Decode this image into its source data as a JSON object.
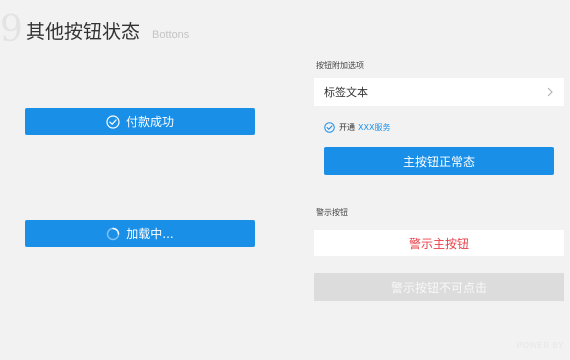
{
  "header": {
    "number": "9",
    "title": "其他按钮状态",
    "subtitle": "Bottons"
  },
  "left": {
    "paid_button": {
      "label": "付款成功",
      "icon": "check-circle-icon"
    },
    "loading_button": {
      "label": "加载中...",
      "icon": "spinner-icon"
    }
  },
  "right": {
    "addon_section": {
      "label": "按钮附加选项",
      "tag_row": {
        "text": "标签文本",
        "icon": "chevron-right-icon"
      },
      "agree": {
        "text": "开通",
        "link": "XXX服务",
        "icon": "check-circle-icon"
      },
      "primary_button": {
        "label": "主按钮正常态"
      }
    },
    "warn_section": {
      "label": "警示按钮",
      "warn_button": {
        "label": "警示主按钮"
      },
      "disabled_button": {
        "label": "警示按钮不可点击"
      }
    }
  },
  "footer": {
    "mark": "POWER BY"
  },
  "colors": {
    "primary": "#1a8fe8",
    "warn": "#e8404a",
    "disabled": "#dcdcdc",
    "background": "#f2f2f2"
  }
}
